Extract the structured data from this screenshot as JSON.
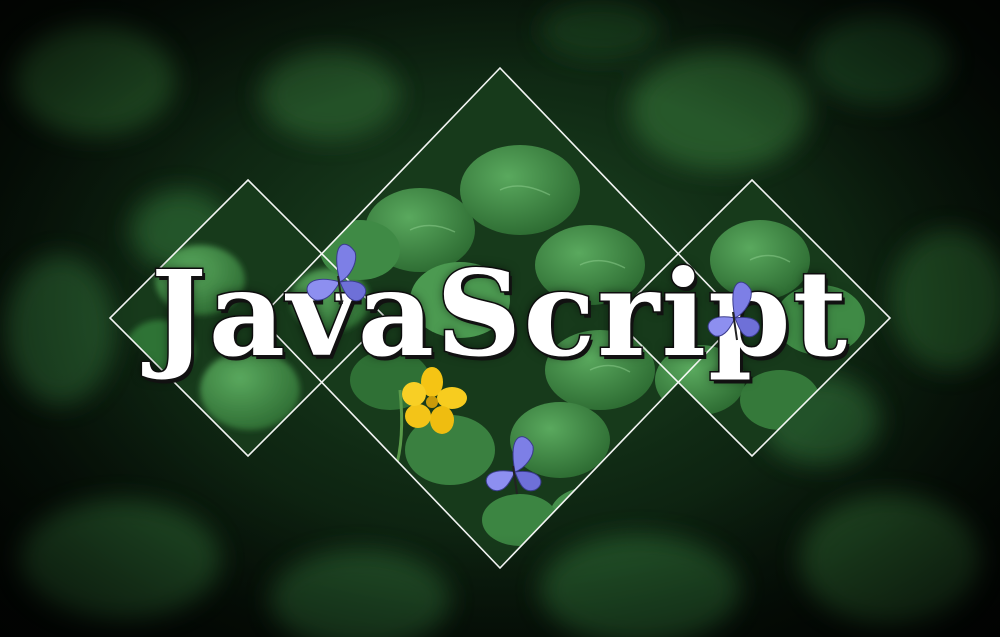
{
  "image": {
    "title_text": "JavaScript",
    "subject": "clover-leaves-with-butterflies",
    "colors": {
      "background_dark": "#071309",
      "leaf": "#3f8a45",
      "leaf_light": "#5aa95e",
      "frame": "#ffffff",
      "flower": "#f5c414",
      "butterfly": "#7d7fe6",
      "title_fill": "#ffffff",
      "title_outline": "#111111"
    }
  }
}
